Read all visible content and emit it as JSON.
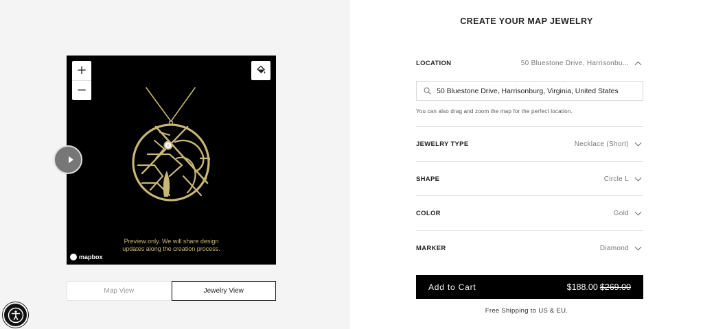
{
  "preview": {
    "zoom_in_label": "+",
    "zoom_out_label": "−",
    "note_line1": "Preview only. We will share design",
    "note_line2": "updates along the creation process.",
    "mapbox_label": "mapbox",
    "icons": {
      "paint": "paint-bucket-icon",
      "play": "play-icon",
      "accessibility": "accessibility-icon"
    }
  },
  "view_toggle": {
    "map_view": "Map View",
    "jewelry_view": "Jewelry View",
    "selected": "Jewelry View"
  },
  "configurator": {
    "title": "CREATE YOUR MAP JEWELRY",
    "location": {
      "label": "LOCATION",
      "value": "50 Bluestone Drive, Harrisonbu...",
      "search_value": "50 Bluestone Drive, Harrisonburg, Virginia, United States",
      "helper": "You can also drag and zoom the map for the perfect location."
    },
    "options": [
      {
        "label": "JEWELRY TYPE",
        "value": "Necklace (Short)"
      },
      {
        "label": "SHAPE",
        "value": "Circle L"
      },
      {
        "label": "COLOR",
        "value": "Gold"
      },
      {
        "label": "MARKER",
        "value": "Diamond"
      }
    ]
  },
  "cart": {
    "label": "Add to Cart",
    "price": "$188.00",
    "original_price": "$269.00",
    "shipping": "Free Shipping to US & EU."
  },
  "colors": {
    "gold": "#c9b776",
    "black": "#000000",
    "panel_bg": "#f4f4f4"
  }
}
